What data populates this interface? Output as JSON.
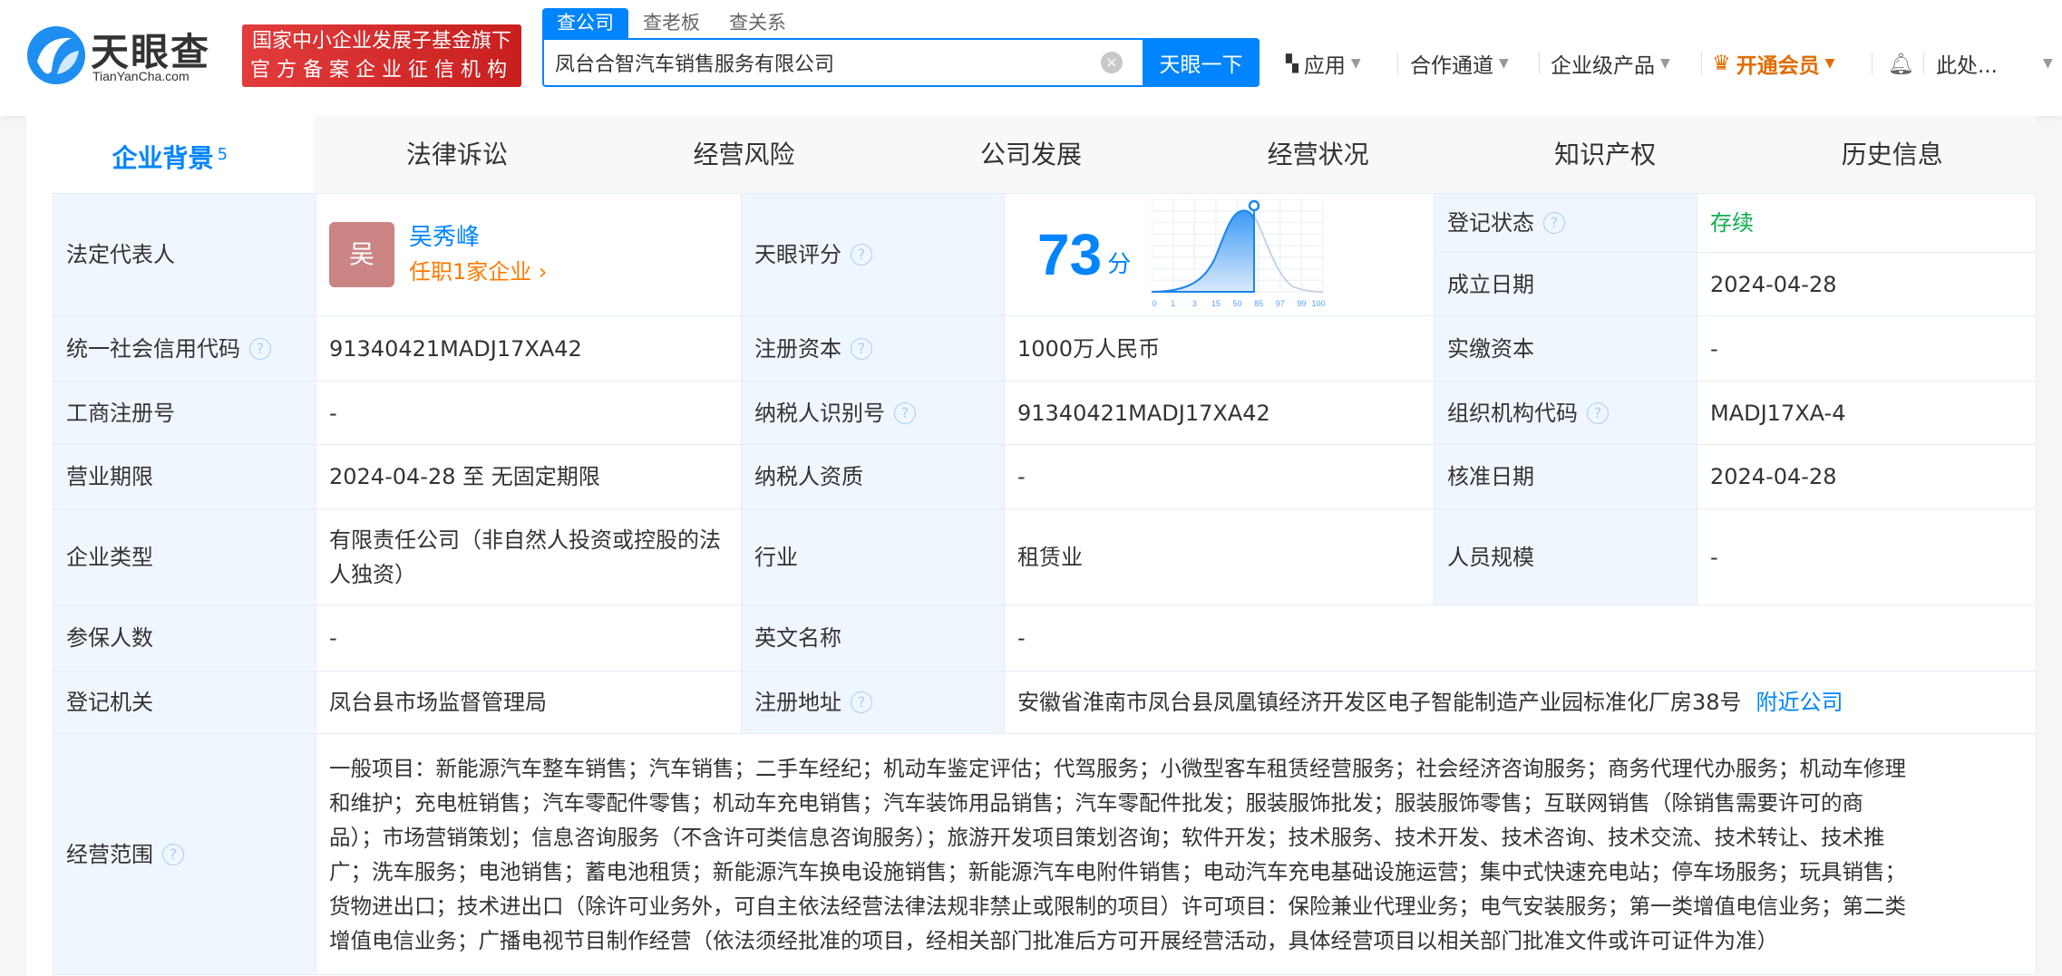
{
  "header": {
    "logo_text": "天眼查",
    "logo_sub": "TianYanCha.com",
    "badge_line1": "国家中小企业发展子基金旗下",
    "badge_line2": "官方备案企业征信机构",
    "search_tabs": [
      "查公司",
      "查老板",
      "查关系"
    ],
    "search_value": "凤台合智汽车销售服务有限公司",
    "search_button": "天眼一下",
    "nav": {
      "apps": "应用",
      "partner": "合作通道",
      "enterprise": "企业级产品",
      "vip": "开通会员",
      "user": "此处..."
    }
  },
  "tabs": [
    {
      "label": "企业背景",
      "count": "5"
    },
    {
      "label": "法律诉讼"
    },
    {
      "label": "经营风险"
    },
    {
      "label": "公司发展"
    },
    {
      "label": "经营状况"
    },
    {
      "label": "知识产权"
    },
    {
      "label": "历史信息"
    }
  ],
  "info": {
    "legal_rep_label": "法定代表人",
    "legal_rep_avatar": "吴",
    "legal_rep_name": "吴秀峰",
    "legal_rep_link": "任职1家企业 ›",
    "status_label": "登记状态",
    "status": "存续",
    "found_label": "成立日期",
    "found": "2024-04-28",
    "score_label": "天眼评分",
    "score": "73",
    "score_unit": "分",
    "credit_label": "统一社会信用代码",
    "credit": "91340421MADJ17XA42",
    "capital_label": "注册资本",
    "capital": "1000万人民币",
    "paid_label": "实缴资本",
    "paid": "-",
    "reg_no_label": "工商注册号",
    "reg_no": "-",
    "tax_label": "纳税人识别号",
    "tax": "91340421MADJ17XA42",
    "org_label": "组织机构代码",
    "org": "MADJ17XA-4",
    "term_label": "营业期限",
    "term": "2024-04-28 至 无固定期限",
    "tax_qual_label": "纳税人资质",
    "tax_qual": "-",
    "approve_label": "核准日期",
    "approve": "2024-04-28",
    "type_label": "企业类型",
    "type": "有限责任公司（非自然人投资或控股的法人独资）",
    "industry_label": "行业",
    "industry": "租赁业",
    "staff_label": "人员规模",
    "staff": "-",
    "insured_label": "参保人数",
    "insured": "-",
    "en_label": "英文名称",
    "en": "-",
    "authority_label": "登记机关",
    "authority": "凤台县市场监督管理局",
    "address_label": "注册地址",
    "address": "安徽省淮南市凤台县凤凰镇经济开发区电子智能制造产业园标准化厂房38号",
    "nearby": "附近公司",
    "scope_label": "经营范围",
    "scope_lines": [
      "一般项目：新能源汽车整车销售；汽车销售；二手车经纪；机动车鉴定评估；代驾服务；小微型客车租赁经营服务；社会经济咨询服务；商务代理代办服务；机动车修理",
      "和维护；充电桩销售；汽车零配件零售；机动车充电销售；汽车装饰用品销售；汽车零配件批发；服装服饰批发；服装服饰零售；互联网销售（除销售需要许可的商",
      "品）；市场营销策划；信息咨询服务（不含许可类信息咨询服务）；旅游开发项目策划咨询；软件开发；技术服务、技术开发、技术咨询、技术交流、技术转让、技术推",
      "广；洗车服务；电池销售；蓄电池租赁；新能源汽车换电设施销售；新能源汽车电附件销售；电动汽车充电基础设施运营；集中式快速充电站；停车场服务；玩具销售；",
      "货物进出口；技术进出口（除许可业务外，可自主依法经营法律法规非禁止或限制的项目）许可项目：保险兼业代理业务；电气安装服务；第一类增值电信业务；第二类",
      "增值电信业务；广播电视节目制作经营（依法须经批准的项目，经相关部门批准后方可开展经营活动，具体经营项目以相关部门批准文件或许可证件为准）"
    ]
  },
  "score_chart": {
    "ticks": [
      "0",
      "1",
      "3",
      "15",
      "50",
      "85",
      "97",
      "99",
      "100"
    ]
  },
  "colors": {
    "accent": "#0084ff",
    "vip": "#e06c00",
    "status": "#0cad4e",
    "badge": "#d42b2b"
  }
}
